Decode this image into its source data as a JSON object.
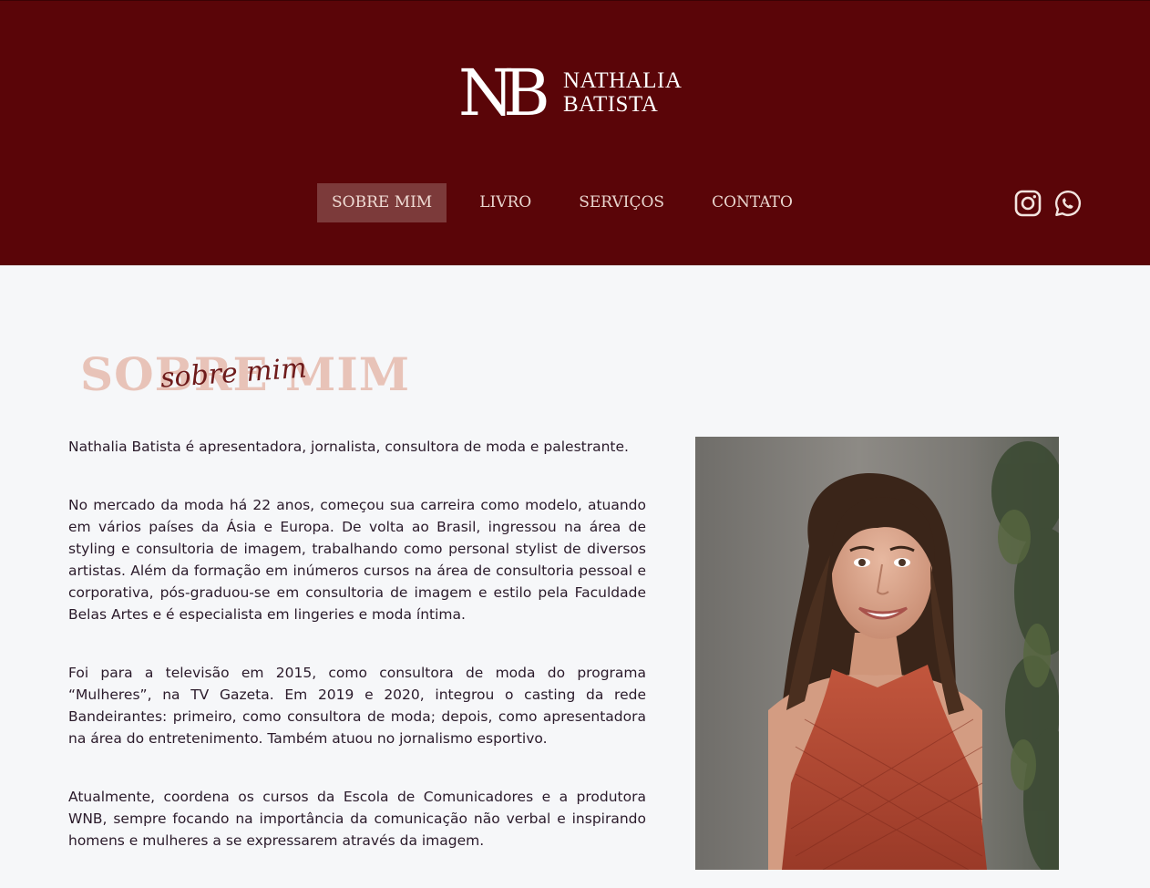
{
  "brand": {
    "monogram": "NB",
    "name_line1": "NATHALIA",
    "name_line2": "BATISTA"
  },
  "nav": {
    "items": [
      {
        "label": "SOBRE MIM"
      },
      {
        "label": "LIVRO"
      },
      {
        "label": "SERVIÇOS"
      },
      {
        "label": "CONTATO"
      }
    ]
  },
  "social": {
    "icons": [
      "instagram-icon",
      "whatsapp-icon"
    ]
  },
  "section": {
    "title": "SOBRE MIM",
    "script_title": "sobre mim"
  },
  "bio": {
    "paragraphs": [
      "Nathalia Batista é apresentadora, jornalista, consultora de moda e palestrante.",
      "No mercado da moda há 22 anos, começou sua carreira como modelo, atuando em vários países da Ásia e Europa. De volta ao Brasil, ingressou na área de styling e consultoria de imagem, trabalhando como personal stylist de diversos artistas. Além da formação em inúmeros cursos na área de consultoria pessoal e corporativa, pós-graduou-se em consultoria de imagem e estilo pela Faculdade Belas Artes e é especialista em lingeries e moda íntima.",
      "Foi para a televisão em 2015, como consultora de moda do programa “Mulheres”, na TV Gazeta. Em 2019 e 2020, integrou o casting da rede Bandeirantes: primeiro, como consultora de moda; depois, como apresentadora na área do entretenimento. Também atuou no jornalismo esportivo.",
      "Atualmente, coordena os cursos da Escola de Comunicadores e a produtora WNB, sempre focando na importância da comunicação não verbal e inspirando homens e mulheres a se expressarem através da imagem."
    ]
  },
  "colors": {
    "header_bg": "#5a0508",
    "nav_active_bg": "#7c3a3a",
    "title_light": "#e8c3b8",
    "script_dark": "#6e1b1b",
    "page_bg": "#f6f7f9"
  }
}
